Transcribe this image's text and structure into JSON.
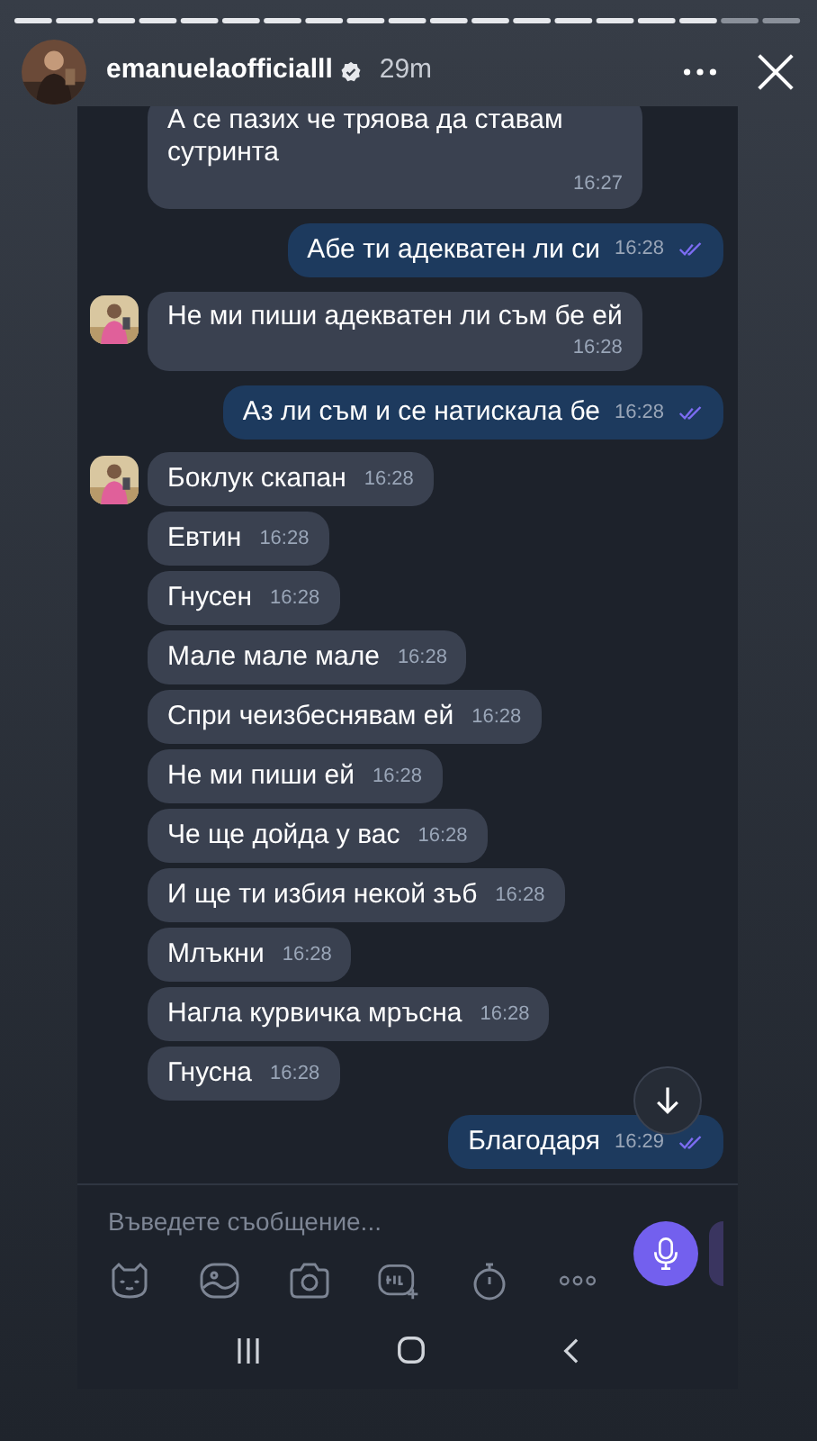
{
  "story": {
    "username": "emanuelaofficialll",
    "verified": true,
    "time": "29m"
  },
  "messages": [
    {
      "kind": "incoming",
      "avatar": false,
      "time_below": true,
      "text": "А се пазих че тряова да ставам сутринта",
      "time": "16:27"
    },
    {
      "kind": "outgoing",
      "read": true,
      "text": "Абе ти адекватен ли си",
      "time": "16:28"
    },
    {
      "kind": "incoming",
      "avatar": true,
      "time_below": true,
      "text": "Не ми пиши адекватен ли съм бе ей",
      "time": "16:28"
    },
    {
      "kind": "outgoing",
      "read": true,
      "text": "Аз ли съм и се натискала бе",
      "time": "16:28"
    },
    {
      "kind": "incoming",
      "avatar": true,
      "time_below": false,
      "text": "Боклук скапан",
      "time": "16:28"
    },
    {
      "kind": "incoming",
      "avatar": false,
      "time_below": false,
      "text": "Евтин",
      "time": "16:28"
    },
    {
      "kind": "incoming",
      "avatar": false,
      "time_below": false,
      "text": "Гнусен",
      "time": "16:28"
    },
    {
      "kind": "incoming",
      "avatar": false,
      "time_below": false,
      "text": "Мале мале мале",
      "time": "16:28"
    },
    {
      "kind": "incoming",
      "avatar": false,
      "time_below": false,
      "text": "Спри чеизбеснявам ей",
      "time": "16:28"
    },
    {
      "kind": "incoming",
      "avatar": false,
      "time_below": false,
      "text": "Не ми пиши ей",
      "time": "16:28"
    },
    {
      "kind": "incoming",
      "avatar": false,
      "time_below": false,
      "text": "Че ще дойда у вас",
      "time": "16:28"
    },
    {
      "kind": "incoming",
      "avatar": false,
      "time_below": false,
      "text": "И ще ти избия некой зъб",
      "time": "16:28"
    },
    {
      "kind": "incoming",
      "avatar": false,
      "time_below": false,
      "text": "Млъкни",
      "time": "16:28"
    },
    {
      "kind": "incoming",
      "avatar": false,
      "time_below": false,
      "text": "Нагла курвичка мръсна",
      "time": "16:28"
    },
    {
      "kind": "incoming",
      "avatar": false,
      "time_below": false,
      "text": "Гнусна",
      "time": "16:28"
    },
    {
      "kind": "outgoing",
      "read": true,
      "text": "Благодаря",
      "time": "16:29"
    }
  ],
  "composer": {
    "placeholder": "Въведете съобщение..."
  }
}
